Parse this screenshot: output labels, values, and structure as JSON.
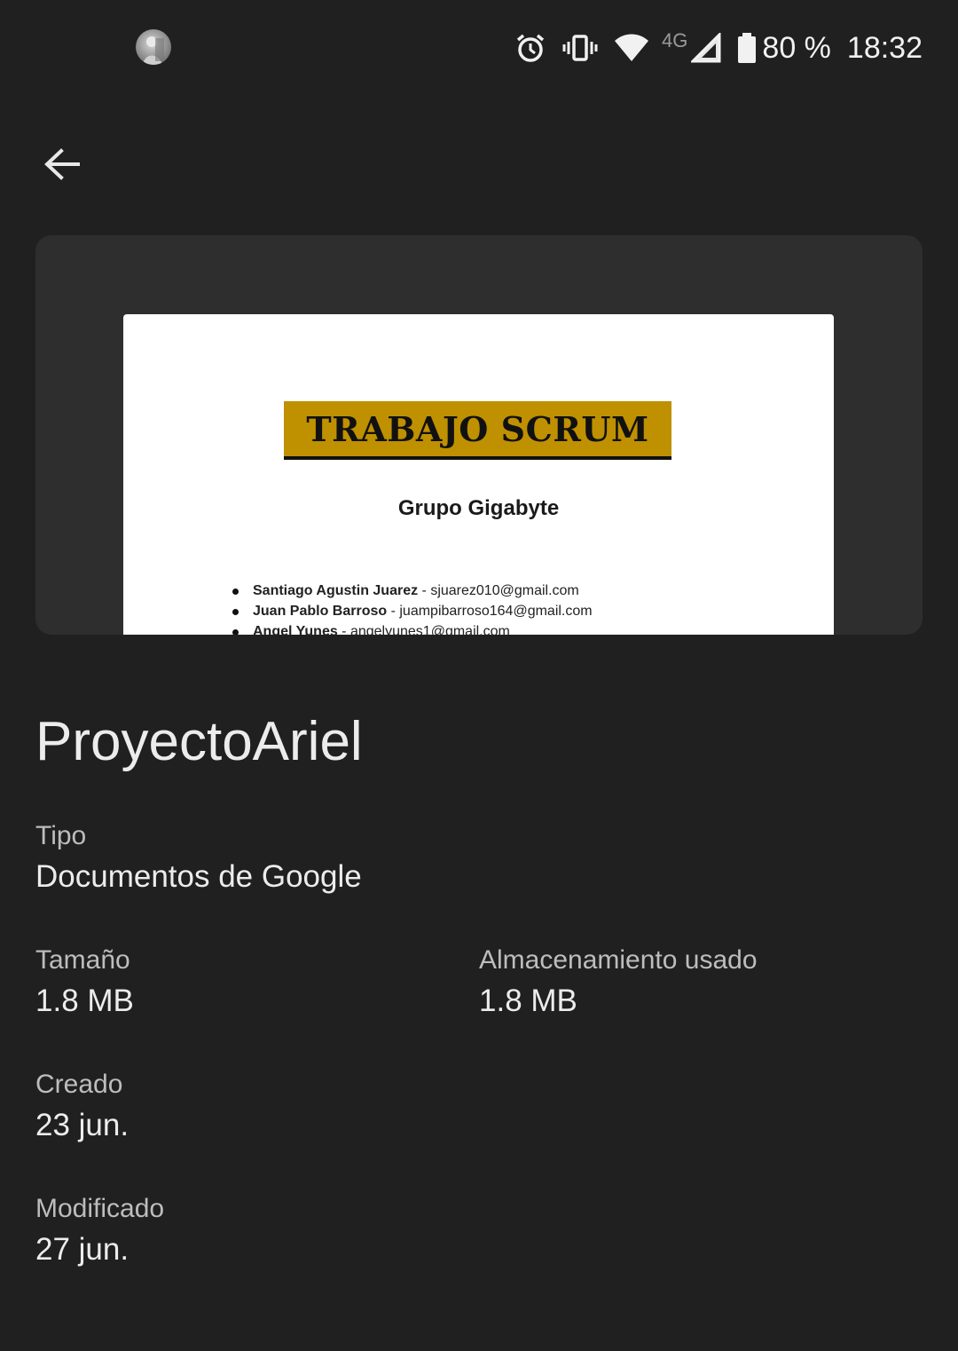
{
  "status_bar": {
    "network": "4G",
    "battery": "80 %",
    "time": "18:32",
    "icons": [
      "avatar-icon",
      "alarm-icon",
      "vibrate-icon",
      "wifi-icon",
      "signal-icon",
      "battery-icon"
    ]
  },
  "header": {
    "back_icon": "arrow-left-icon"
  },
  "preview": {
    "doc_title": "TRABAJO SCRUM",
    "doc_subtitle": "Grupo Gigabyte",
    "members": [
      {
        "name": "Santiago Agustin Juarez",
        "email": " - sjuarez010@gmail.com"
      },
      {
        "name": "Juan Pablo Barroso",
        "email": " - juampibarroso164@gmail.com"
      },
      {
        "name": "Angel Yunes",
        "email": " - angelyunes1@gmail.com"
      }
    ],
    "accent_color": "#bf9000"
  },
  "file": {
    "name": "ProyectoAriel",
    "type_label": "Tipo",
    "type_value": "Documentos de Google",
    "size_label": "Tamaño",
    "size_value": "1.8 MB",
    "storage_label": "Almacenamiento usado",
    "storage_value": "1.8 MB",
    "created_label": "Creado",
    "created_value": "23 jun.",
    "modified_label": "Modificado",
    "modified_value": "27 jun."
  }
}
